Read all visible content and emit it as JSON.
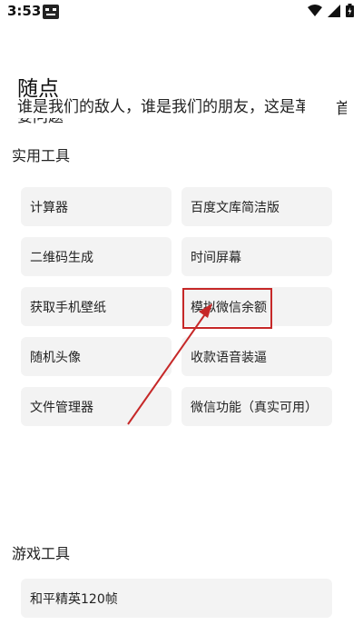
{
  "status_bar": {
    "time": "3:53"
  },
  "hero": {
    "title": "随点",
    "quote": "谁是我们的敌人，谁是我们的朋友，这是革",
    "quote_tail": "首",
    "quote_line2": "要问题"
  },
  "practical_tools": {
    "title": "实用工具",
    "items": [
      "计算器",
      "百度文库简洁版",
      "二维码生成",
      "时间屏幕",
      "获取手机壁纸",
      "模拟微信余额",
      "随机头像",
      "收款语音装逼",
      "文件管理器",
      "微信功能（真实可用）"
    ]
  },
  "game_tools": {
    "title": "游戏工具",
    "items": [
      "和平精英120帧"
    ]
  },
  "colors": {
    "highlight": "#c62828",
    "card_bg": "#f3f3f3"
  }
}
